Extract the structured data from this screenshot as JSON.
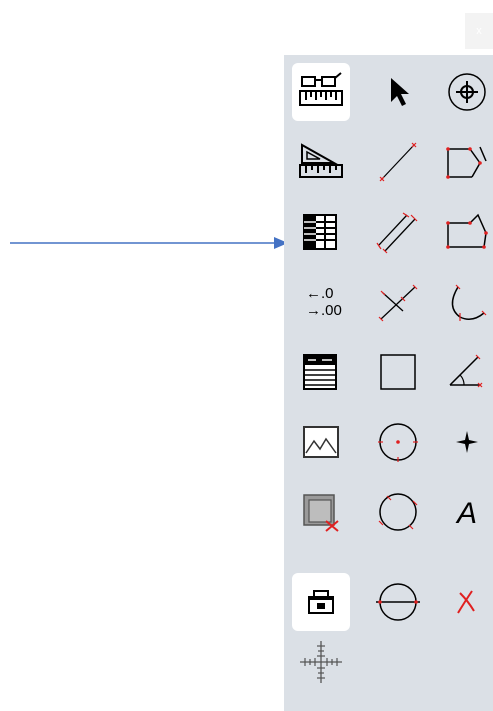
{
  "window": {
    "close_label": "x"
  },
  "toolbar": {
    "tools": [
      {
        "icon": "measure-glasses-ruler-icon",
        "active": true
      },
      {
        "icon": "select-arrow-icon",
        "active": false
      },
      {
        "icon": "crosshair-target-icon",
        "active": false
      },
      {
        "icon": "ruler-protractor-icon",
        "active": false
      },
      {
        "icon": "line-icon",
        "active": false
      },
      {
        "icon": "polyline-open-icon",
        "active": false
      },
      {
        "icon": "table-grid-icon",
        "active": false
      },
      {
        "icon": "parallel-lines-icon",
        "active": false
      },
      {
        "icon": "polygon-icon",
        "active": false
      },
      {
        "icon": "decimal-precision-icon",
        "active": false,
        "label_top": "←.0",
        "label_bottom": "→.00"
      },
      {
        "icon": "perpendicular-line-icon",
        "active": false
      },
      {
        "icon": "arc-icon",
        "active": false
      },
      {
        "icon": "text-list-icon",
        "active": false
      },
      {
        "icon": "rectangle-icon",
        "active": false
      },
      {
        "icon": "angle-icon",
        "active": false
      },
      {
        "icon": "image-icon",
        "active": false
      },
      {
        "icon": "circle-center-icon",
        "active": false
      },
      {
        "icon": "point-plus-icon",
        "active": false
      },
      {
        "icon": "layer-delete-icon",
        "active": false
      },
      {
        "icon": "circle-three-point-icon",
        "active": false
      },
      {
        "icon": "text-annotation-icon",
        "active": false,
        "label": "A"
      },
      {
        "icon": "printer-icon",
        "active": true
      },
      {
        "icon": "circle-diameter-icon",
        "active": false
      },
      {
        "icon": "delete-mark-icon",
        "active": false
      },
      {
        "icon": "scale-crosshair-icon",
        "active": false
      }
    ]
  },
  "annotation": {
    "arrow_color": "#4472c4",
    "accent_red": "#e02020"
  }
}
